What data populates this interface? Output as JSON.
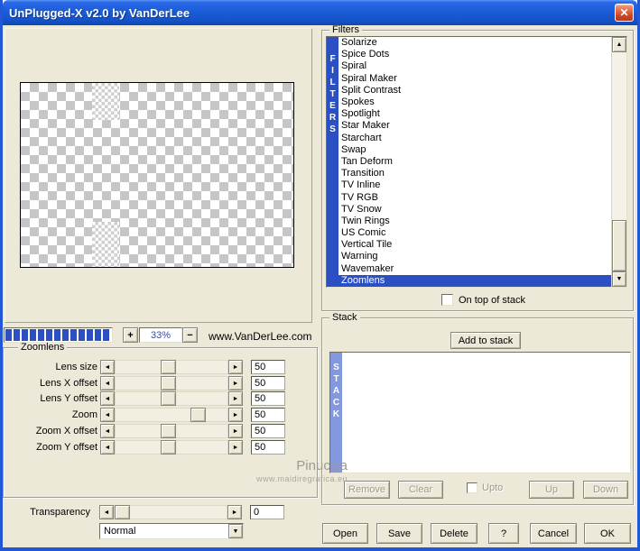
{
  "colors": {
    "dialog_bg": "#ECE9D8",
    "border_blue": "#2258D8",
    "accent_blue": "#2B50C4",
    "stack_blue": "#8398DE",
    "close_red": "#D9532B",
    "zoom_text_blue": "#3A4DA5",
    "disabled_text": "#9D9A8B"
  },
  "icons": {
    "close": "✕",
    "left_arrow": "◄",
    "right_arrow": "►",
    "up_arrow": "▲",
    "down_arrow": "▼",
    "dropdown_arrow": "▼",
    "plus": "+",
    "minus": "−"
  },
  "window": {
    "title": "UnPlugged-X v2.0 by VanDerLee"
  },
  "preview": {
    "zoom_level": "33%",
    "website": "www.VanDerLee.com"
  },
  "filters": {
    "group_label": "Filters",
    "vertical_label": "FILTERS",
    "items": [
      "Solarize",
      "Spice Dots",
      "Spiral",
      "Spiral Maker",
      "Split Contrast",
      "Spokes",
      "Spotlight",
      "Star Maker",
      "Starchart",
      "Swap",
      "Tan Deform",
      "Transition",
      "TV Inline",
      "TV RGB",
      "TV Snow",
      "Twin Rings",
      "US Comic",
      "Vertical Tile",
      "Warning",
      "Wavemaker",
      "Zoomlens"
    ],
    "selected_item": "Zoomlens",
    "on_top_label": "On top of stack"
  },
  "zoomlens": {
    "group_label": "Zoomlens",
    "sliders": [
      {
        "label": "Lens size",
        "value": "50"
      },
      {
        "label": "Lens X offset",
        "value": "50"
      },
      {
        "label": "Lens Y offset",
        "value": "50"
      },
      {
        "label": "Zoom",
        "value": "50"
      },
      {
        "label": "Zoom X offset",
        "value": "50"
      },
      {
        "label": "Zoom Y offset",
        "value": "50"
      }
    ]
  },
  "transparency": {
    "label": "Transparency",
    "value": "0",
    "blend_mode": "Normal"
  },
  "stack": {
    "group_label": "Stack",
    "vertical_label": "STACK",
    "add_button": "Add to stack",
    "remove_button": "Remove",
    "clear_button": "Clear",
    "upto_label": "Upto",
    "up_button": "Up",
    "down_button": "Down"
  },
  "footer": {
    "open": "Open",
    "save": "Save",
    "delete": "Delete",
    "help": "?",
    "cancel": "Cancel",
    "ok": "OK"
  },
  "watermark": {
    "line1": "Pinuccia",
    "line2": "www.maidiregrafica.eu"
  }
}
